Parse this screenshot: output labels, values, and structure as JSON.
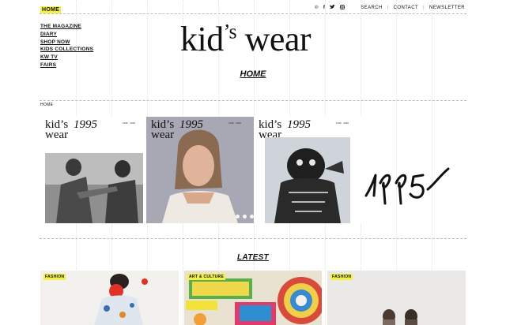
{
  "header": {
    "home_tag": "HOME",
    "social_icons": [
      "pinterest-icon",
      "facebook-icon",
      "twitter-icon",
      "instagram-icon"
    ],
    "search": "SEARCH",
    "contact": "CONTACT",
    "newsletter": "NEWSLETTER"
  },
  "sidebar": {
    "items": [
      {
        "label": "THE MAGAZINE"
      },
      {
        "label": "DIARY"
      },
      {
        "label": "SHOP NOW"
      },
      {
        "label": "KIDS COLLECTIONS"
      },
      {
        "label": "KW TV"
      },
      {
        "label": "FAIRS"
      }
    ]
  },
  "logo": {
    "main": "kid",
    "sup": "’s",
    "rest": " wear"
  },
  "page_title": "HOME",
  "breadcrumb": "HOME",
  "carousel": {
    "covers": [
      {
        "brand_top": "kid’s",
        "brand_bottom": "wear",
        "script": "1995",
        "meta": "1995 · 2020"
      },
      {
        "brand_top": "kid’s",
        "brand_bottom": "wear",
        "script": "1995",
        "meta": "1995 · 2020"
      },
      {
        "brand_top": "kid’s",
        "brand_bottom": "wear",
        "script": "1995",
        "meta": "1995 · 2020"
      }
    ],
    "signature": "1995"
  },
  "latest": {
    "title": "LATEST",
    "cards": [
      {
        "tag": "FASHION"
      },
      {
        "tag": "ART & CULTURE"
      },
      {
        "tag": "FASHION"
      }
    ]
  },
  "colors": {
    "accent": "#f2ef4a"
  }
}
